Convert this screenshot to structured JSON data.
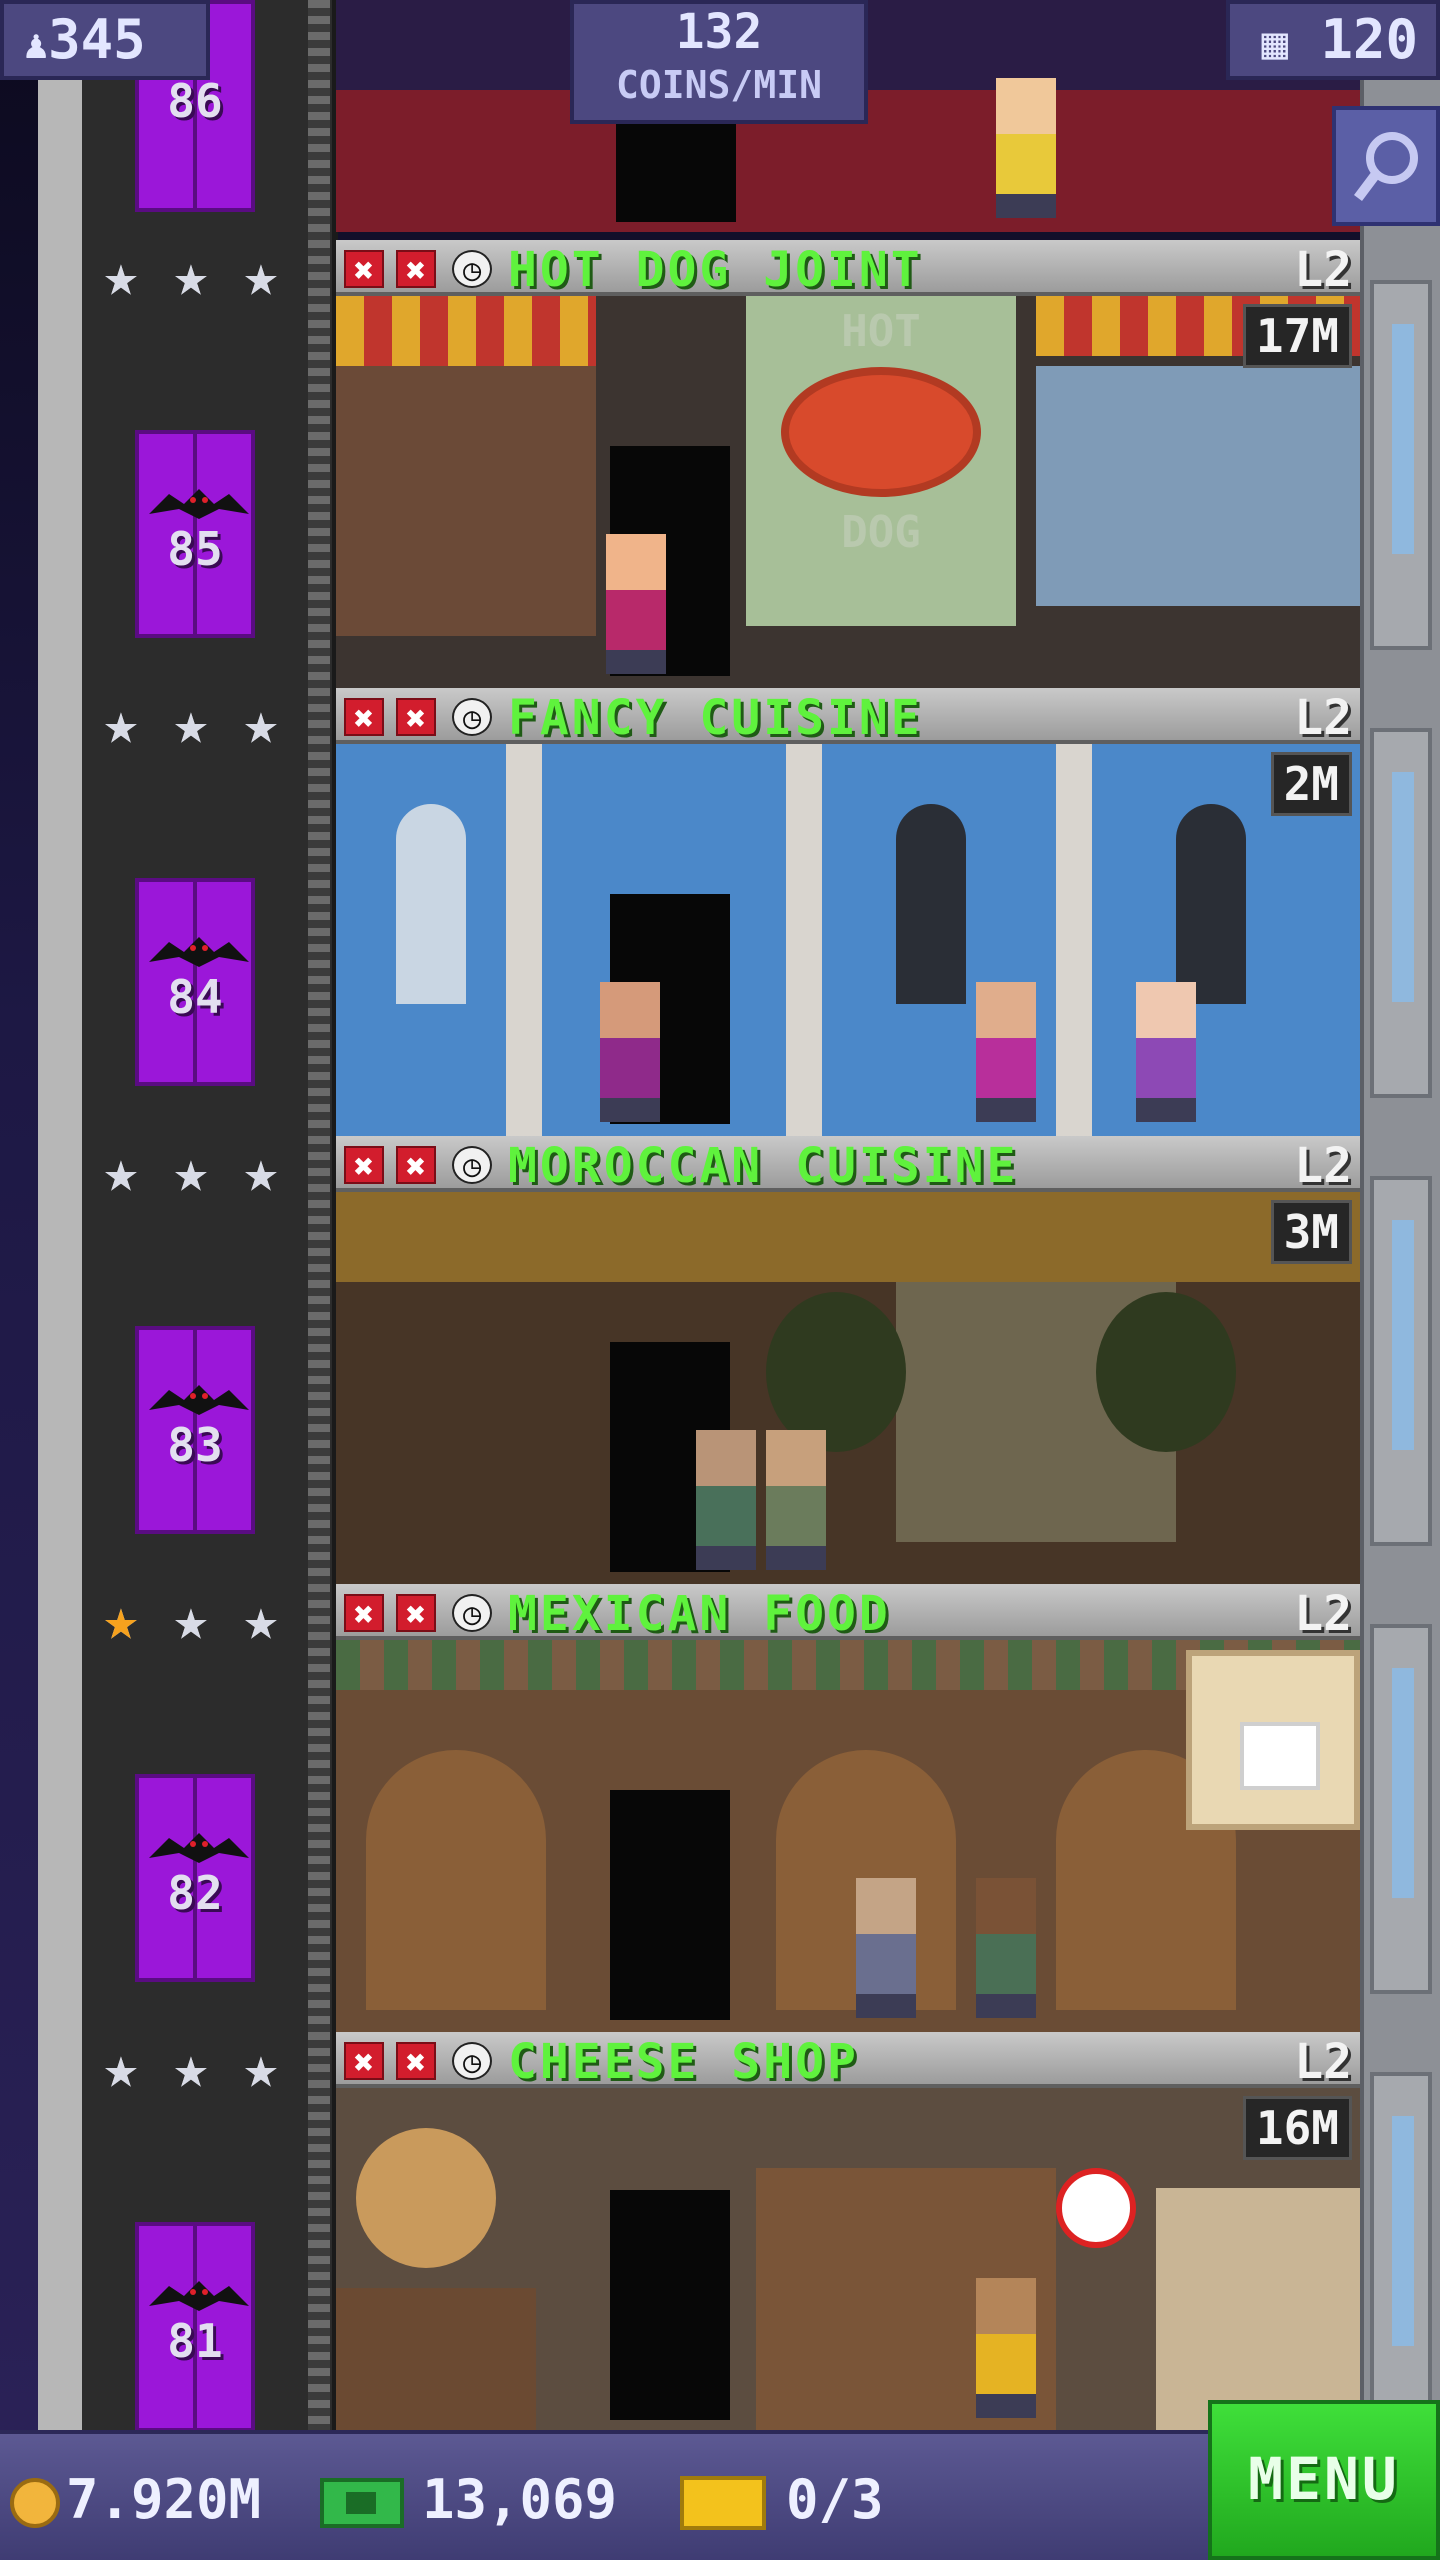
{
  "header": {
    "population": "345",
    "coins_rate_value": "132",
    "coins_rate_label": "COINS/MIN",
    "floors": "120"
  },
  "top_floor": {
    "elevator_number": "86"
  },
  "floors": [
    {
      "elevator_number": "85",
      "name": "HOT DOG JOINT",
      "level": "L2",
      "time": "17M",
      "stars": [
        "silver",
        "silver",
        "silver"
      ],
      "sign_top": "HOT",
      "sign_bottom": "DOG"
    },
    {
      "elevator_number": "84",
      "name": "FANCY CUISINE",
      "level": "L2",
      "time": "2M",
      "stars": [
        "silver",
        "silver",
        "silver"
      ]
    },
    {
      "elevator_number": "83",
      "name": "MOROCCAN CUISINE",
      "level": "L2",
      "time": "3M",
      "stars": [
        "silver",
        "silver",
        "silver"
      ]
    },
    {
      "elevator_number": "82",
      "name": "MEXICAN FOOD",
      "level": "L2",
      "time": "",
      "stars": [
        "gold",
        "silver",
        "silver"
      ]
    },
    {
      "elevator_number": "81",
      "name": "CHEESE SHOP",
      "level": "L2",
      "time": "16M",
      "stars": [
        "silver",
        "silver",
        "silver"
      ]
    }
  ],
  "bottom": {
    "coins": "7.920M",
    "bux": "13,069",
    "tickets": "0/3",
    "menu_label": "MENU"
  },
  "colors": {
    "elevator": "#9b17d9",
    "floor_name": "#5ff23d",
    "menu_button": "#2fc92b",
    "hud": "#4c4880"
  },
  "icons": {
    "population": "person-icon",
    "floors": "building-icon",
    "search": "magnifier-icon",
    "status_bad": "x-icon",
    "status_time": "clock-icon",
    "coins": "coin-icon",
    "bux": "cash-icon",
    "tickets": "ticket-icon",
    "pot": "pot-icon"
  }
}
